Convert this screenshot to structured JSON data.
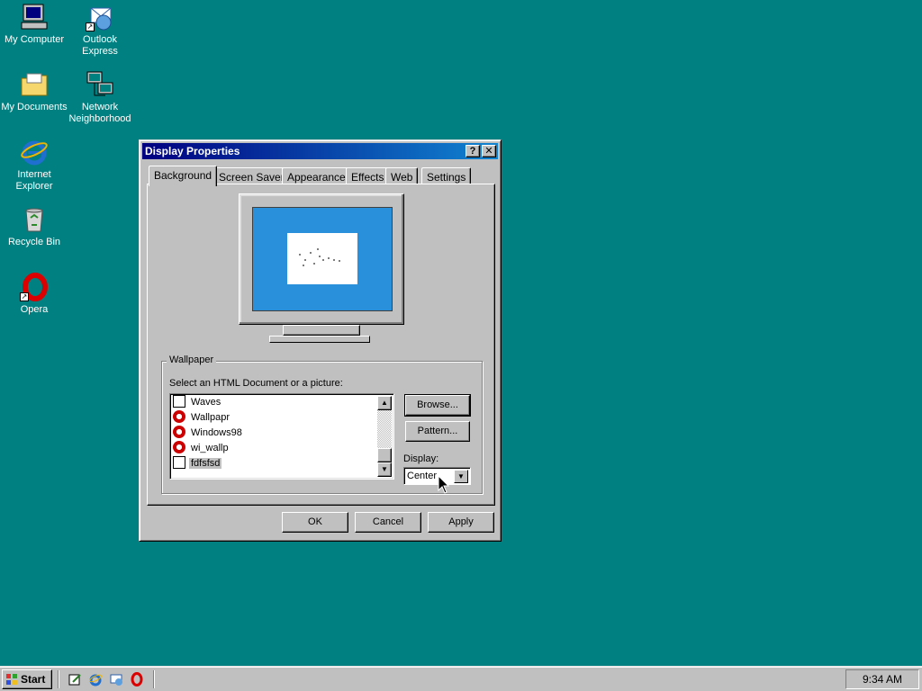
{
  "desktop": {
    "icons": [
      {
        "label": "My Computer"
      },
      {
        "label": "Outlook Express"
      },
      {
        "label": "My Documents"
      },
      {
        "label": "Network Neighborhood"
      },
      {
        "label": "Internet Explorer"
      },
      {
        "label": "Recycle Bin"
      },
      {
        "label": "Opera"
      }
    ]
  },
  "window": {
    "title": "Display Properties",
    "help_glyph": "?",
    "close_glyph": "✕",
    "tabs": [
      {
        "label": "Background",
        "active": true
      },
      {
        "label": "Screen Saver"
      },
      {
        "label": "Appearance"
      },
      {
        "label": "Effects"
      },
      {
        "label": "Web"
      },
      {
        "label": "Settings"
      }
    ],
    "wallpaper": {
      "group_label": "Wallpaper",
      "select_label": "Select an HTML Document or a picture:",
      "items": [
        {
          "label": "Waves",
          "icon": "bitmap-icon"
        },
        {
          "label": "Wallpapr",
          "icon": "opera-file-icon"
        },
        {
          "label": "Windows98",
          "icon": "opera-file-icon"
        },
        {
          "label": "wi_wallp",
          "icon": "opera-file-icon"
        },
        {
          "label": "fdfsfsd",
          "icon": "bitmap-icon",
          "selected": true
        }
      ],
      "browse_label": "Browse...",
      "pattern_label": "Pattern...",
      "display_label": "Display:",
      "display_value": "Center"
    },
    "ok_label": "OK",
    "cancel_label": "Cancel",
    "apply_label": "Apply"
  },
  "taskbar": {
    "start_label": "Start",
    "clock": "9:34 AM"
  },
  "colors": {
    "desktop": "#008080",
    "titlebar": "#000080",
    "preview_bg": "#2990dc"
  }
}
